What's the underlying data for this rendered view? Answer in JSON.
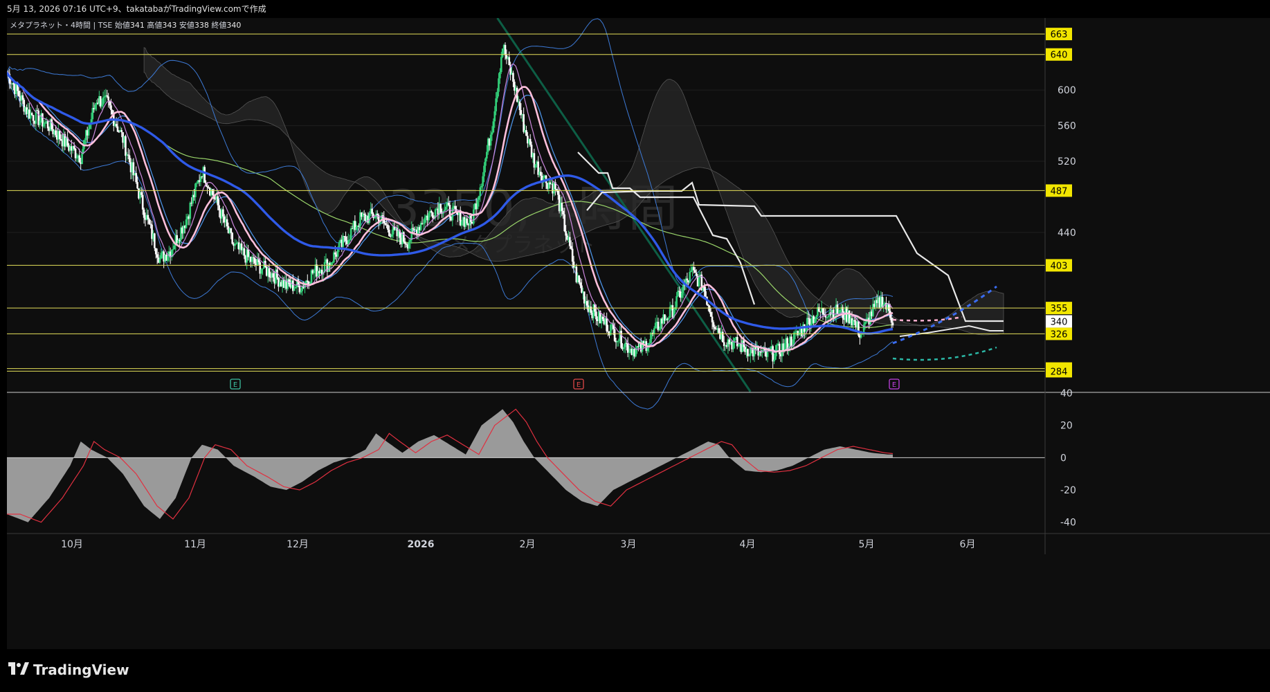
{
  "header": {
    "caption": "5月 13, 2026 07:16 UTC+9、takatabaがTradingView.comで作成"
  },
  "legend": {
    "symbol": "メタプラネット・4時間",
    "exchange": "TSE",
    "open_label": "始値",
    "open": "341",
    "high_label": "高値",
    "high": "343",
    "low_label": "安値",
    "low": "338",
    "close_label": "終値",
    "close": "340"
  },
  "watermark": {
    "main": "3350, 4時間",
    "sub": "メタプラネット"
  },
  "brand": {
    "name": "TradingView",
    "icon": "tradingview-logo-icon"
  },
  "colors": {
    "background": "#0e0e0e",
    "grid": "#1e1e1e",
    "up": "#33d17a",
    "down": "#ffffff",
    "level_line": "#e6e05a",
    "level_tag_bg": "#f2e600",
    "sma_fast": "#ffc0dc",
    "sma_mid": "#cc88dd",
    "sma_slow": "#2f5ae8",
    "bollinger": "#3d7ad6",
    "sma_long": "#9ad56a",
    "trend_line": "#0d5e45",
    "histogram": "#9a9a9a",
    "signal": "#e03040",
    "teal_projection": "#2bb8a6"
  },
  "chart_data": {
    "type": "candlestick",
    "price_axis": {
      "ticks": [
        600,
        560,
        520,
        440
      ],
      "range": [
        261,
        681
      ]
    },
    "levels": [
      663,
      640,
      487,
      403,
      355,
      326,
      287,
      284
    ],
    "current_price": 340,
    "time_axis": [
      "10月",
      "11月",
      "12月",
      "2026",
      "2月",
      "3月",
      "4月",
      "5月",
      "6月"
    ],
    "earnings_markers": [
      "E",
      "E",
      "E"
    ],
    "price_path": [
      [
        0,
        620
      ],
      [
        4,
        575
      ],
      [
        8,
        560
      ],
      [
        12,
        535
      ],
      [
        14,
        525
      ],
      [
        17,
        590
      ],
      [
        19,
        585
      ],
      [
        22,
        545
      ],
      [
        26,
        465
      ],
      [
        29,
        410
      ],
      [
        31,
        420
      ],
      [
        34,
        455
      ],
      [
        37,
        510
      ],
      [
        40,
        470
      ],
      [
        43,
        425
      ],
      [
        47,
        405
      ],
      [
        50,
        395
      ],
      [
        53,
        380
      ],
      [
        56,
        380
      ],
      [
        58,
        395
      ],
      [
        61,
        405
      ],
      [
        64,
        430
      ],
      [
        67,
        455
      ],
      [
        70,
        460
      ],
      [
        73,
        440
      ],
      [
        76,
        430
      ],
      [
        79,
        455
      ],
      [
        82,
        470
      ],
      [
        85,
        460
      ],
      [
        88,
        450
      ],
      [
        90,
        500
      ],
      [
        92,
        560
      ],
      [
        94,
        650
      ],
      [
        96,
        610
      ],
      [
        98,
        560
      ],
      [
        100,
        520
      ],
      [
        102,
        500
      ],
      [
        104,
        490
      ],
      [
        106,
        440
      ],
      [
        108,
        390
      ],
      [
        110,
        360
      ],
      [
        112,
        345
      ],
      [
        114,
        335
      ],
      [
        116,
        322
      ],
      [
        118,
        310
      ],
      [
        120,
        308
      ],
      [
        122,
        320
      ],
      [
        124,
        340
      ],
      [
        126,
        350
      ],
      [
        128,
        375
      ],
      [
        130,
        395
      ],
      [
        132,
        380
      ],
      [
        134,
        340
      ],
      [
        136,
        320
      ],
      [
        138,
        315
      ],
      [
        140,
        310
      ],
      [
        142,
        305
      ],
      [
        144,
        302
      ],
      [
        146,
        305
      ],
      [
        148,
        315
      ],
      [
        150,
        325
      ],
      [
        152,
        340
      ],
      [
        154,
        350
      ],
      [
        156,
        352
      ],
      [
        158,
        350
      ],
      [
        160,
        345
      ],
      [
        162,
        325
      ],
      [
        164,
        350
      ],
      [
        166,
        365
      ],
      [
        168,
        342
      ]
    ],
    "macd": {
      "axis_ticks": [
        40,
        20,
        0,
        -20,
        -40
      ],
      "range": [
        -47,
        40
      ],
      "histogram": [
        [
          0,
          -35
        ],
        [
          4,
          -40
        ],
        [
          8,
          -25
        ],
        [
          12,
          -5
        ],
        [
          14,
          10
        ],
        [
          16,
          5
        ],
        [
          19,
          0
        ],
        [
          22,
          -10
        ],
        [
          26,
          -30
        ],
        [
          29,
          -38
        ],
        [
          32,
          -25
        ],
        [
          35,
          0
        ],
        [
          37,
          8
        ],
        [
          40,
          5
        ],
        [
          43,
          -5
        ],
        [
          47,
          -12
        ],
        [
          50,
          -18
        ],
        [
          53,
          -20
        ],
        [
          56,
          -15
        ],
        [
          59,
          -8
        ],
        [
          62,
          -3
        ],
        [
          65,
          0
        ],
        [
          68,
          5
        ],
        [
          70,
          15
        ],
        [
          72,
          10
        ],
        [
          75,
          3
        ],
        [
          78,
          10
        ],
        [
          81,
          14
        ],
        [
          84,
          8
        ],
        [
          87,
          2
        ],
        [
          90,
          20
        ],
        [
          92,
          25
        ],
        [
          94,
          30
        ],
        [
          96,
          22
        ],
        [
          98,
          10
        ],
        [
          100,
          0
        ],
        [
          103,
          -10
        ],
        [
          106,
          -20
        ],
        [
          109,
          -27
        ],
        [
          112,
          -30
        ],
        [
          115,
          -20
        ],
        [
          118,
          -15
        ],
        [
          121,
          -10
        ],
        [
          124,
          -5
        ],
        [
          127,
          0
        ],
        [
          130,
          5
        ],
        [
          133,
          10
        ],
        [
          135,
          8
        ],
        [
          137,
          0
        ],
        [
          140,
          -8
        ],
        [
          143,
          -9
        ],
        [
          146,
          -8
        ],
        [
          149,
          -5
        ],
        [
          152,
          0
        ],
        [
          155,
          5
        ],
        [
          158,
          7
        ],
        [
          161,
          5
        ],
        [
          164,
          3
        ],
        [
          167,
          2
        ]
      ]
    }
  }
}
